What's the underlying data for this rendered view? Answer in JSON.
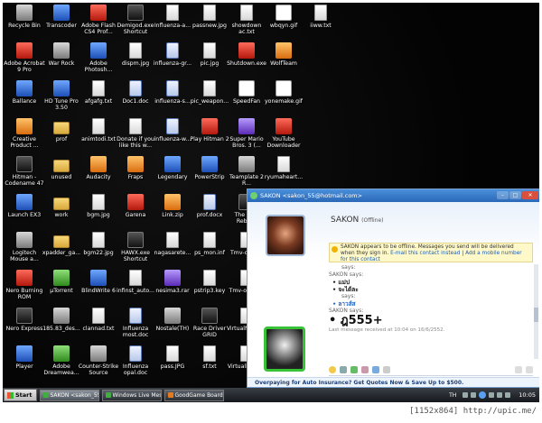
{
  "desktop": {
    "icons": [
      {
        "label": "Recycle Bin",
        "style": "g-gray",
        "icon": "recycle-bin-icon"
      },
      {
        "label": "Transcoder",
        "style": "g-blue",
        "icon": "app-icon"
      },
      {
        "label": "Adobe Flash CS4 Prof...",
        "style": "g-red",
        "icon": "flash-icon"
      },
      {
        "label": "Demigod.exe Shortcut",
        "style": "g-dark",
        "icon": "game-icon"
      },
      {
        "label": "Influenza-a...",
        "style": "g-file",
        "icon": "file-icon"
      },
      {
        "label": "passnew.jpg",
        "style": "g-file",
        "icon": "image-file-icon"
      },
      {
        "label": "showdown ac.txt",
        "style": "g-file",
        "icon": "text-file-icon"
      },
      {
        "label": "wbqyn.gif",
        "style": "g-white",
        "icon": "gif-file-icon"
      },
      {
        "label": "iiww.txt",
        "style": "g-file",
        "icon": "text-file-icon"
      },
      {
        "label": "Adobe Acrobat 9 Pro",
        "style": "g-red",
        "icon": "acrobat-icon"
      },
      {
        "label": "War Rock",
        "style": "g-gray",
        "icon": "game-icon"
      },
      {
        "label": "Adobe Photosh...",
        "style": "g-blue",
        "icon": "photoshop-icon"
      },
      {
        "label": "dispm.jpg",
        "style": "g-file",
        "icon": "image-file-icon"
      },
      {
        "label": "influenza-gr...",
        "style": "g-doc",
        "icon": "document-icon"
      },
      {
        "label": "pic.jpg",
        "style": "g-file",
        "icon": "image-file-icon"
      },
      {
        "label": "Shutdown.exe",
        "style": "g-red",
        "icon": "shutdown-icon"
      },
      {
        "label": "WolfTeam",
        "style": "g-orange",
        "icon": "game-icon"
      },
      {
        "label": "Ballance",
        "style": "g-blue",
        "icon": "game-icon"
      },
      {
        "label": "HD Tune Pro 3.50",
        "style": "g-blue",
        "icon": "app-icon"
      },
      {
        "label": "afgafg.txt",
        "style": "g-file",
        "icon": "text-file-icon"
      },
      {
        "label": "Doc1.doc",
        "style": "g-doc",
        "icon": "word-document-icon"
      },
      {
        "label": "influenza-s...",
        "style": "g-doc",
        "icon": "document-icon"
      },
      {
        "label": "pic_weapon...",
        "style": "g-file",
        "icon": "image-file-icon"
      },
      {
        "label": "SpeedFan",
        "style": "g-white",
        "icon": "fan-icon"
      },
      {
        "label": "yonemake.gif",
        "style": "g-white",
        "icon": "gif-file-icon"
      },
      {
        "label": "Creative Product ...",
        "style": "g-orange",
        "icon": "app-icon"
      },
      {
        "label": "prof",
        "style": "g-folder",
        "icon": "folder-icon"
      },
      {
        "label": "animtodi.txt",
        "style": "g-file",
        "icon": "text-file-icon"
      },
      {
        "label": "Donate if you like this w...",
        "style": "g-file",
        "icon": "text-file-icon"
      },
      {
        "label": "influenza-w...",
        "style": "g-doc",
        "icon": "document-icon"
      },
      {
        "label": "Play Hitman 2",
        "style": "g-red",
        "icon": "game-icon"
      },
      {
        "label": "Super Mario Bros. 3 (...",
        "style": "g-purple",
        "icon": "game-icon"
      },
      {
        "label": "YouTube Downloader",
        "style": "g-red",
        "icon": "youtube-icon"
      },
      {
        "label": "Hitman - Codename 47",
        "style": "g-dark",
        "icon": "game-icon"
      },
      {
        "label": "unused",
        "style": "g-folder",
        "icon": "folder-icon"
      },
      {
        "label": "Audacity",
        "style": "g-orange",
        "icon": "audacity-icon"
      },
      {
        "label": "Fraps",
        "style": "g-orange",
        "icon": "fraps-icon"
      },
      {
        "label": "Legendary",
        "style": "g-blue",
        "icon": "game-icon"
      },
      {
        "label": "PowerStrip",
        "style": "g-blue",
        "icon": "app-icon"
      },
      {
        "label": "Teamplate 2 R...",
        "style": "g-gray",
        "icon": "app-icon"
      },
      {
        "label": "ryumaheart...",
        "style": "g-file",
        "icon": "text-file-icon"
      },
      {
        "label": "Launch EX3",
        "style": "g-blue",
        "icon": "app-icon"
      },
      {
        "label": "work",
        "style": "g-folder",
        "icon": "folder-icon"
      },
      {
        "label": "bgm.jpg",
        "style": "g-file",
        "icon": "image-file-icon"
      },
      {
        "label": "Garena",
        "style": "g-red",
        "icon": "garena-icon"
      },
      {
        "label": "Link.zip",
        "style": "g-orange",
        "icon": "zip-icon"
      },
      {
        "label": "prof.docx",
        "style": "g-doc",
        "icon": "word-document-icon"
      },
      {
        "label": "The Lord Rebirth",
        "style": "g-dark",
        "icon": "game-icon"
      },
      {
        "label": "Logitech Mouse a...",
        "style": "g-gray",
        "icon": "mouse-icon"
      },
      {
        "label": "xpadder_ga...",
        "style": "g-folder",
        "icon": "folder-icon"
      },
      {
        "label": "bgm22.jpg",
        "style": "g-file",
        "icon": "image-file-icon"
      },
      {
        "label": "HAWX.exe Shortcut",
        "style": "g-dark",
        "icon": "game-icon"
      },
      {
        "label": "nagasarete...",
        "style": "g-file",
        "icon": "text-file-icon"
      },
      {
        "label": "ps_mon.inf",
        "style": "g-file",
        "icon": "config-file-icon"
      },
      {
        "label": "Tmv-oclai...",
        "style": "g-file",
        "icon": "file-icon"
      },
      {
        "label": "Nero Burning ROM",
        "style": "g-red",
        "icon": "nero-icon"
      },
      {
        "label": "µTorrent",
        "style": "g-green",
        "icon": "utorrent-icon"
      },
      {
        "label": "BlindWrite 6",
        "style": "g-blue",
        "icon": "app-icon"
      },
      {
        "label": "infinst_auto...",
        "style": "g-file",
        "icon": "file-icon"
      },
      {
        "label": "nesima3.rar",
        "style": "g-purple",
        "icon": "rar-icon"
      },
      {
        "label": "pstrip3.key",
        "style": "g-file",
        "icon": "key-file-icon"
      },
      {
        "label": "Tmv-octah...",
        "style": "g-file",
        "icon": "file-icon"
      },
      {
        "label": "Nero Express",
        "style": "g-dark",
        "icon": "nero-icon"
      },
      {
        "label": "185.83_des...",
        "style": "g-gray",
        "icon": "installer-icon"
      },
      {
        "label": "clannad.txt",
        "style": "g-file",
        "icon": "text-file-icon"
      },
      {
        "label": "Influenza most.doc",
        "style": "g-doc",
        "icon": "word-document-icon"
      },
      {
        "label": "Nostale(TH)",
        "style": "g-gray",
        "icon": "game-icon"
      },
      {
        "label": "Race Driver GRID",
        "style": "g-dark",
        "icon": "game-icon"
      },
      {
        "label": "VirtualNES.e...",
        "style": "g-file",
        "icon": "file-icon"
      },
      {
        "label": "Player",
        "style": "g-blue",
        "icon": "player-icon"
      },
      {
        "label": "Adobe Dreamwea...",
        "style": "g-green",
        "icon": "dreamweaver-icon"
      },
      {
        "label": "Counter-Strike Source",
        "style": "g-gray",
        "icon": "game-icon"
      },
      {
        "label": "Influenza opal.doc",
        "style": "g-doc",
        "icon": "word-document-icon"
      },
      {
        "label": "pass.JPG",
        "style": "g-file",
        "icon": "image-file-icon"
      },
      {
        "label": "sf.txt",
        "style": "g-file",
        "icon": "text-file-icon"
      },
      {
        "label": "VirtualNES.i...",
        "style": "g-file",
        "icon": "file-icon"
      }
    ]
  },
  "messenger": {
    "title": "SAKON <sakon_55@hotmail.com>",
    "contact_name": "SAKON",
    "contact_status": "(Offline)",
    "warning": {
      "text": "SAKON appears to be offline. Messages you send will be delivered when they sign in.",
      "link1": "E-mail this contact instead",
      "separator": " | ",
      "link2": "Add a mobile number for this contact"
    },
    "conversation": {
      "says1": "says:",
      "says2": "SAKON says:",
      "msg1": "แม่ป",
      "msg2": "จะได้ละ",
      "says3": "says:",
      "msg3": "ลาวส์ส",
      "says4": "SAKON says:",
      "big_msg": "ฎ555+",
      "last_received": "Last message received at 10:04 on 16/6/2552."
    },
    "ad_text": "Overpaying for Auto Insurance? Get Quotes Now & Save Up to $500."
  },
  "taskbar": {
    "start_label": "Start",
    "tasks": [
      {
        "label": "SAKON <sakon_55@h...",
        "color": "#3fae3f",
        "active": true
      },
      {
        "label": "Windows Live Messenger",
        "color": "#3fae3f",
        "active": false
      },
      {
        "label": "GoodGame Board :: Spec...",
        "color": "#e37a20",
        "active": false
      }
    ],
    "language": "TH",
    "clock": "10:05"
  },
  "caption": "[1152x864] http://upic.me/"
}
